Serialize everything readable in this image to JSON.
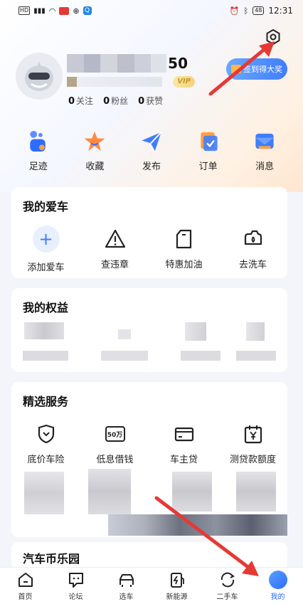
{
  "status_bar": {
    "time": "12:31",
    "battery": "48",
    "hd_label": "HD"
  },
  "profile": {
    "name_tail": "50",
    "vip_label": "VIP",
    "stats": [
      {
        "count": "0",
        "label": "关注"
      },
      {
        "count": "0",
        "label": "粉丝"
      },
      {
        "count": "0",
        "label": "获赞"
      }
    ],
    "signin_label": "签到得大奖"
  },
  "quick_actions": [
    {
      "label": "足迹",
      "icon": "footprint-icon"
    },
    {
      "label": "收藏",
      "icon": "star-icon"
    },
    {
      "label": "发布",
      "icon": "send-icon"
    },
    {
      "label": "订单",
      "icon": "order-icon"
    },
    {
      "label": "消息",
      "icon": "message-icon"
    }
  ],
  "my_car": {
    "title": "我的爱车",
    "items": [
      {
        "label": "添加爱车",
        "icon": "plus-icon"
      },
      {
        "label": "查违章",
        "icon": "warning-icon"
      },
      {
        "label": "特惠加油",
        "icon": "fuel-icon"
      },
      {
        "label": "去洗车",
        "icon": "car-wash-icon"
      }
    ]
  },
  "benefits": {
    "title": "我的权益"
  },
  "services": {
    "title": "精选服务",
    "items": [
      {
        "label": "底价车险",
        "icon": "shield-icon"
      },
      {
        "label": "低息借钱",
        "icon": "loan-50k-icon",
        "icon_text": "50万"
      },
      {
        "label": "车主贷",
        "icon": "card-icon"
      },
      {
        "label": "测贷款额度",
        "icon": "calendar-yen-icon"
      }
    ]
  },
  "fun_park": {
    "title": "汽车币乐园"
  },
  "bottom_nav": [
    {
      "label": "首页",
      "icon": "home-icon"
    },
    {
      "label": "论坛",
      "icon": "forum-icon"
    },
    {
      "label": "选车",
      "icon": "car-select-icon"
    },
    {
      "label": "新能源",
      "icon": "ev-icon"
    },
    {
      "label": "二手车",
      "icon": "used-car-icon"
    },
    {
      "label": "我的",
      "icon": "profile-icon",
      "active": true
    }
  ],
  "colors": {
    "accent": "#2d6cff",
    "arrow": "#e53935"
  }
}
